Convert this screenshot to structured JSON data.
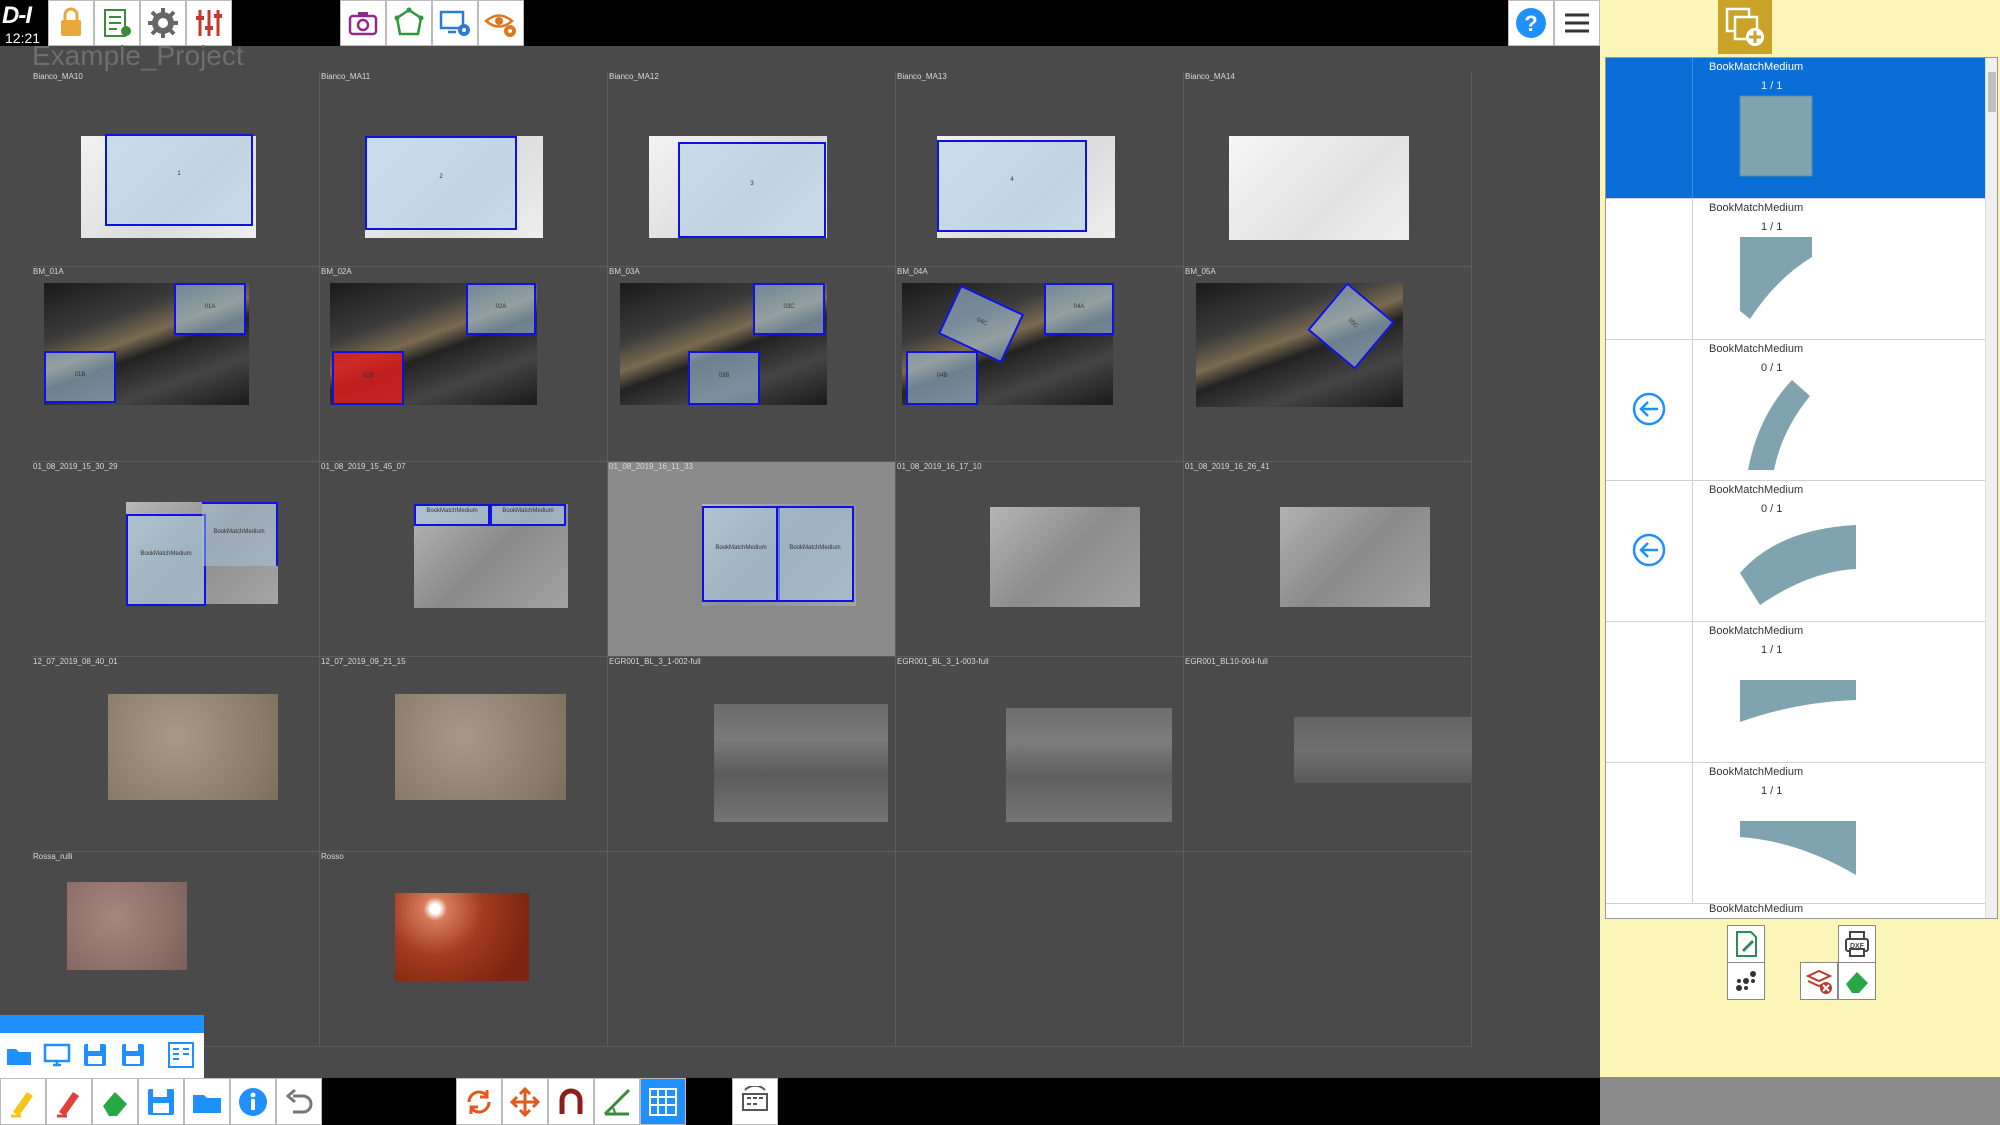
{
  "app": {
    "logo": "D-I",
    "clock": "12:21",
    "project_title": "Example_Project"
  },
  "toolbar_top": {
    "left_icons": [
      "lock-icon",
      "checklist-icon",
      "gear-icon",
      "sliders-icon"
    ],
    "center_icons": [
      "camera-icon",
      "shape-edit-icon",
      "monitor-settings-icon",
      "view-settings-icon"
    ],
    "right_icons": [
      "help-icon",
      "menu-icon"
    ]
  },
  "slabs": [
    {
      "label": "Bianco_MA10",
      "pieces": [
        {
          "text": "1"
        }
      ]
    },
    {
      "label": "Bianco_MA11",
      "pieces": [
        {
          "text": "2"
        }
      ]
    },
    {
      "label": "Bianco_MA12",
      "pieces": [
        {
          "text": "3"
        }
      ]
    },
    {
      "label": "Bianco_MA13",
      "pieces": [
        {
          "text": "4"
        }
      ]
    },
    {
      "label": "Bianco_MA14",
      "pieces": []
    },
    {
      "label": "BM_01A",
      "pieces": [
        {
          "text": "01A"
        },
        {
          "text": "01B"
        }
      ]
    },
    {
      "label": "BM_02A",
      "pieces": [
        {
          "text": "02A"
        },
        {
          "text": "02B"
        }
      ]
    },
    {
      "label": "BM_03A",
      "pieces": [
        {
          "text": "03C"
        },
        {
          "text": "03B"
        }
      ]
    },
    {
      "label": "BM_04A",
      "pieces": [
        {
          "text": "04C"
        },
        {
          "text": "04A"
        },
        {
          "text": "04B"
        }
      ]
    },
    {
      "label": "BM_05A",
      "pieces": [
        {
          "text": "05C"
        }
      ]
    },
    {
      "label": "01_08_2019_15_30_29",
      "pieces": [
        {
          "text": "BookMatchMedium"
        },
        {
          "text": "BookMatchMedium"
        }
      ]
    },
    {
      "label": "01_08_2019_15_45_07",
      "pieces": [
        {
          "text": "BookMatchMedium"
        },
        {
          "text": "BookMatchMedium"
        }
      ]
    },
    {
      "label": "01_08_2019_16_11_33",
      "pieces": [
        {
          "text": "BookMatchMedium"
        },
        {
          "text": "BookMatchMedium"
        }
      ]
    },
    {
      "label": "01_08_2019_16_17_10",
      "pieces": []
    },
    {
      "label": "01_08_2019_16_26_41",
      "pieces": []
    },
    {
      "label": "12_07_2019_08_40_01",
      "pieces": []
    },
    {
      "label": "12_07_2019_09_21_15",
      "pieces": []
    },
    {
      "label": "EGR001_BL_3_1-002-full",
      "pieces": []
    },
    {
      "label": "EGR001_BL_3_1-003-full",
      "pieces": []
    },
    {
      "label": "EGR001_BL10-004-full",
      "pieces": []
    },
    {
      "label": "Rossa_rulli",
      "pieces": []
    },
    {
      "label": "Rosso",
      "pieces": []
    }
  ],
  "piece_list": {
    "items": [
      {
        "name": "BookMatchMedium",
        "count": "1 / 1",
        "active": true,
        "back": false
      },
      {
        "name": "BookMatchMedium",
        "count": "1 / 1",
        "active": false,
        "back": false
      },
      {
        "name": "BookMatchMedium",
        "count": "0 / 1",
        "active": false,
        "back": true
      },
      {
        "name": "BookMatchMedium",
        "count": "0 / 1",
        "active": false,
        "back": true
      },
      {
        "name": "BookMatchMedium",
        "count": "1 / 1",
        "active": false,
        "back": false
      },
      {
        "name": "BookMatchMedium",
        "count": "1 / 1",
        "active": false,
        "back": false
      }
    ],
    "tail_name": "BookMatchMedium"
  },
  "right_panel_buttons": {
    "dxf_label": "DXF"
  },
  "colors": {
    "accent": "#0a6ed8",
    "panel": "#fbf5b8",
    "piece_outline": "#1010e0",
    "shape_fill": "#7fa4b0"
  }
}
